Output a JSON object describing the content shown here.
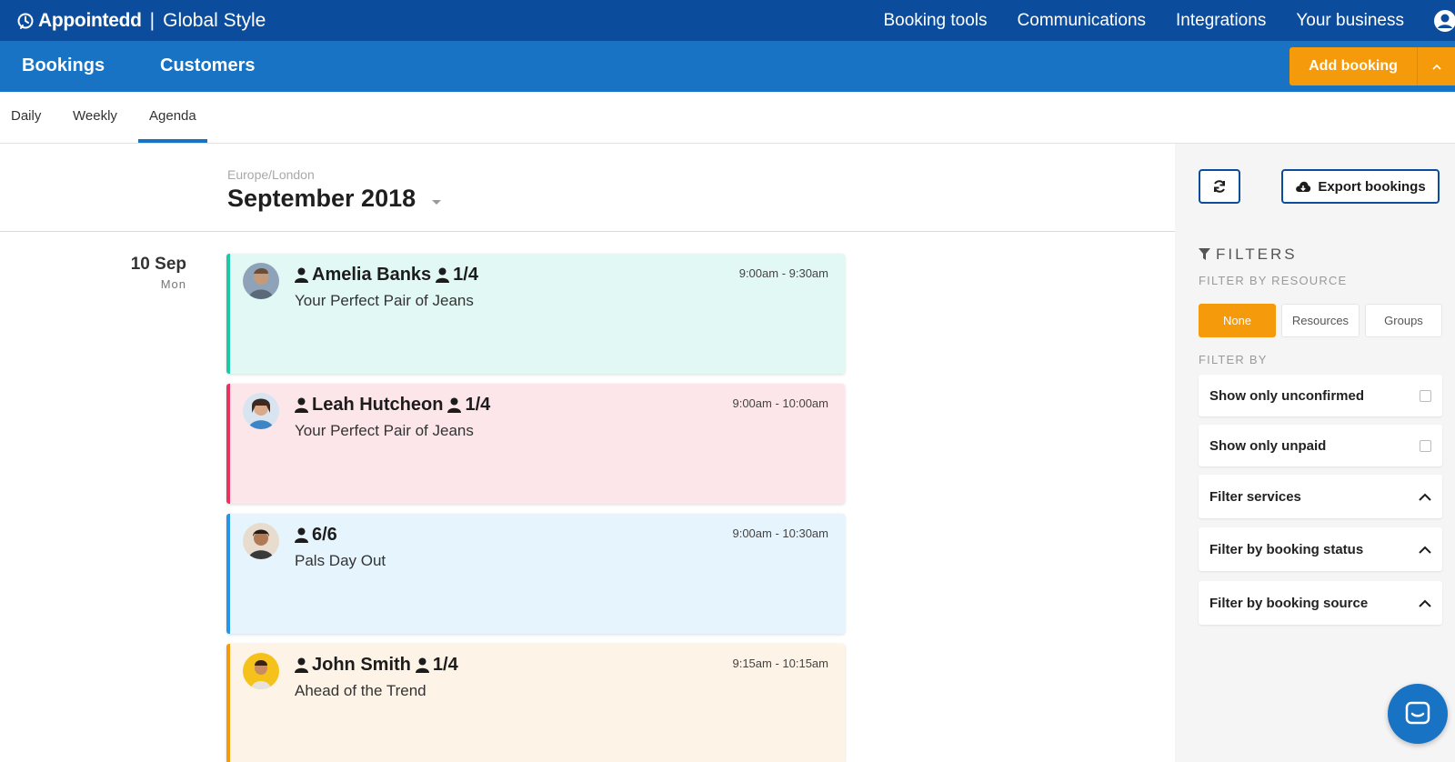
{
  "app": {
    "brand_name": "Appointedd",
    "brand_separator": "|",
    "brand_sub": "Global Style"
  },
  "top_nav": {
    "items": [
      "Booking tools",
      "Communications",
      "Integrations",
      "Your business"
    ]
  },
  "sub_nav": {
    "bookings": "Bookings",
    "customers": "Customers",
    "add_booking": "Add booking"
  },
  "view_tabs": {
    "items": [
      "Daily",
      "Weekly",
      "Agenda"
    ],
    "active": "Agenda"
  },
  "agenda": {
    "timezone": "Europe/London",
    "month": "September 2018",
    "day": {
      "date": "10 Sep",
      "weekday": "Mon"
    },
    "bookings": [
      {
        "customer": "Amelia Banks",
        "capacity": "1/4",
        "service": "Your Perfect Pair of Jeans",
        "time": "9:00am - 9:30am",
        "accent": "#1ec9a6",
        "bg": "#e2f8f4"
      },
      {
        "customer": "Leah Hutcheon",
        "capacity": "1/4",
        "service": "Your Perfect Pair of Jeans",
        "time": "9:00am - 10:00am",
        "accent": "#e9335e",
        "bg": "#fde6ea"
      },
      {
        "customer": "",
        "capacity": "6/6",
        "service": "Pals Day Out",
        "time": "9:00am - 10:30am",
        "accent": "#2595e8",
        "bg": "#e6f4fd"
      },
      {
        "customer": "John Smith",
        "capacity": "1/4",
        "service": "Ahead of the Trend",
        "time": "9:15am - 10:15am",
        "accent": "#f59a0a",
        "bg": "#fdf3e6"
      }
    ]
  },
  "side_panel": {
    "export_label": "Export bookings",
    "filters_title": "FILTERS",
    "filter_by_resource_label": "FILTER BY RESOURCE",
    "resource_options": [
      "None",
      "Resources",
      "Groups"
    ],
    "resource_selected": "None",
    "filter_by_label": "FILTER BY",
    "filters": [
      {
        "label": "Show only unconfirmed",
        "kind": "checkbox"
      },
      {
        "label": "Show only unpaid",
        "kind": "checkbox"
      },
      {
        "label": "Filter services",
        "kind": "collapse"
      },
      {
        "label": "Filter by booking status",
        "kind": "collapse"
      },
      {
        "label": "Filter by booking source",
        "kind": "collapse"
      }
    ]
  },
  "colors": {
    "top_bar": "#0b4d9c",
    "sub_bar": "#1873c4",
    "accent_orange": "#f59a0a"
  }
}
